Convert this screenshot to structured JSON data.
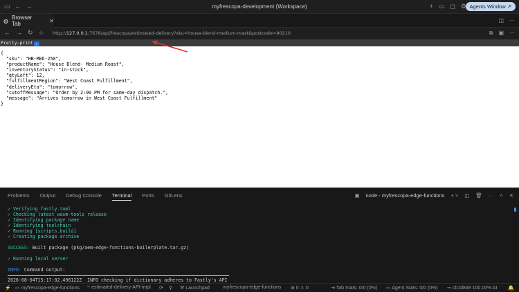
{
  "window": {
    "title": "myfrescopa-development (Workspace)",
    "agents_button": "Agents Window ↗"
  },
  "tab": {
    "label": "Browser Tab"
  },
  "address": {
    "prefix": "http://",
    "host": "127.0.0.1",
    "rest": ":7676/api/frescopa/estimated-delivery?sku=house-blend-medium-roast&postcode=90210"
  },
  "pretty_print": {
    "label": "Pretty-print",
    "checked": true
  },
  "json_lines": [
    "{",
    "  \"sku\": \"HB-MED-250\",",
    "  \"productName\": \"House Blend- Medium Roast\",",
    "  \"inventoryStatus\": \"in-stock\",",
    "  \"qtyLeft\": 12,",
    "  \"fulfillmentRegion\": \"West Coast Fulfillment\",",
    "  \"deliveryEta\": \"tomorrow\",",
    "  \"cutoffMessage\": \"Order by 2:00 PM for same-day dispatch.\",",
    "  \"message\": \"Arrives tomorrow in West Coast Fulfillment\"",
    "}"
  ],
  "panel": {
    "tabs": [
      "Problems",
      "Output",
      "Debug Console",
      "Terminal",
      "Ports",
      "GitLens"
    ],
    "active_tab": "Terminal",
    "terminal_name": "node - myfrescopa-edge-functions"
  },
  "terminal": {
    "steps": [
      "✓ Verifying fastly.toml",
      "✓ Checking latest wasm-tools release",
      "✓ Identifying package name",
      "✓ Identifying toolchain",
      "✓ Running [scripts.build]",
      "✓ Creating package archive"
    ],
    "success_label": "SUCCESS:",
    "success_text": " Built package (pkg/aem-edge-functions-boilerplate.tar.gz)",
    "running": "✓ Running local server",
    "info_label": "INFO:",
    "info_text": " Command output:",
    "last_line": "2026-08-04T15:17:02.496122Z  INFO checking if dictionary adheres to Fastly's API"
  },
  "status": {
    "project": "myfrescopa-edge-functions",
    "branch": "estimated-delivery-API-impl",
    "launchpad": "Launchpad",
    "workspace": "myfrescopa-edge-functions",
    "problems": "⊗ 0 ⚠ 0",
    "tab_stats": "Tab Stats: 0/0 (0%)",
    "agent_stats": "Agent Stats: 0/0 (0%)",
    "commit": "cb1d849 100.00% AI"
  },
  "colors": {
    "accent": "#1a73e8",
    "arrow": "#e0322b",
    "success": "#23d18b",
    "info": "#3b8eea"
  }
}
